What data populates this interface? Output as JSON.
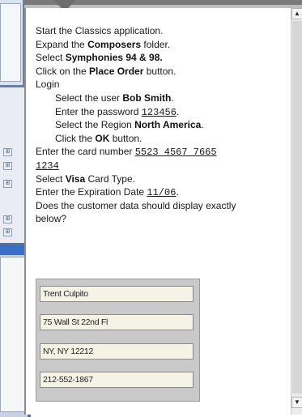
{
  "instructions": {
    "line1_text": "Start the Classics application.",
    "line2_pre": "Expand the ",
    "line2_bold": "Composers",
    "line2_post": " folder.",
    "line3_pre": "Select ",
    "line3_bold": "Symphonies 94 & 98.",
    "line4_pre": "Click on the ",
    "line4_bold": "Place Order",
    "line4_post": " button.",
    "line5_text": "Login",
    "line6_pre": "Select the user ",
    "line6_bold": "Bob Smith",
    "line6_post": ".",
    "line7_pre": "Enter the password ",
    "line7_value": "123456",
    "line7_post": ".",
    "line8_pre": "Select the Region ",
    "line8_bold": "North America",
    "line8_post": ".",
    "line9_pre": "Click the ",
    "line9_bold": "OK",
    "line9_post": " button.",
    "line10_pre": "Enter the card number ",
    "line10_value_a": "5523 4567 7665",
    "line10_value_b": "1234",
    "line11_pre": "Select ",
    "line11_bold": "Visa",
    "line11_post": " Card Type.",
    "line12_pre": "Enter the Expiration Date ",
    "line12_value": "11/06",
    "line12_post": ".",
    "line13_text": "Does the customer data should display exactly below?"
  },
  "customer_data": {
    "name": "Trent Culpito",
    "street": "75 Wall St 22nd Fl",
    "city": "NY, NY 12212",
    "phone": "212-552-1867"
  },
  "scrollbar": {
    "up_arrow": "▲",
    "down_arrow": "▼"
  },
  "left_tree": {
    "icon_glyph": "⊞"
  }
}
